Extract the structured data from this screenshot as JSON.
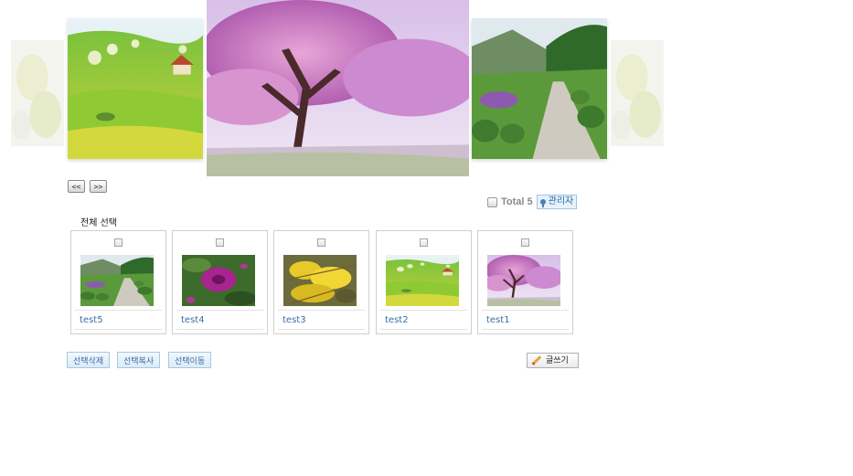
{
  "carousel": {
    "prev_label": "<<",
    "next_label": ">>",
    "slides": [
      "forsythia-blur",
      "green-hill-house",
      "cherry-blossom",
      "garden-path",
      "forsythia-blur"
    ]
  },
  "toolbar": {
    "total_label": "Total 5",
    "admin_label": "관리자"
  },
  "select_all_label": "전체 선택",
  "gallery": {
    "items": [
      {
        "title": "test5",
        "image": "garden-path"
      },
      {
        "title": "test4",
        "image": "purple-flower"
      },
      {
        "title": "test3",
        "image": "forsythia"
      },
      {
        "title": "test2",
        "image": "green-hill-house"
      },
      {
        "title": "test1",
        "image": "cherry-blossom"
      }
    ]
  },
  "actions": {
    "delete_label": "선택삭제",
    "copy_label": "선택복사",
    "move_label": "선택이동",
    "write_label": "글쓰기"
  },
  "colors": {
    "link": "#3a6ea5",
    "button_bg": "#dcebf7",
    "button_border": "#a8c7e2"
  }
}
